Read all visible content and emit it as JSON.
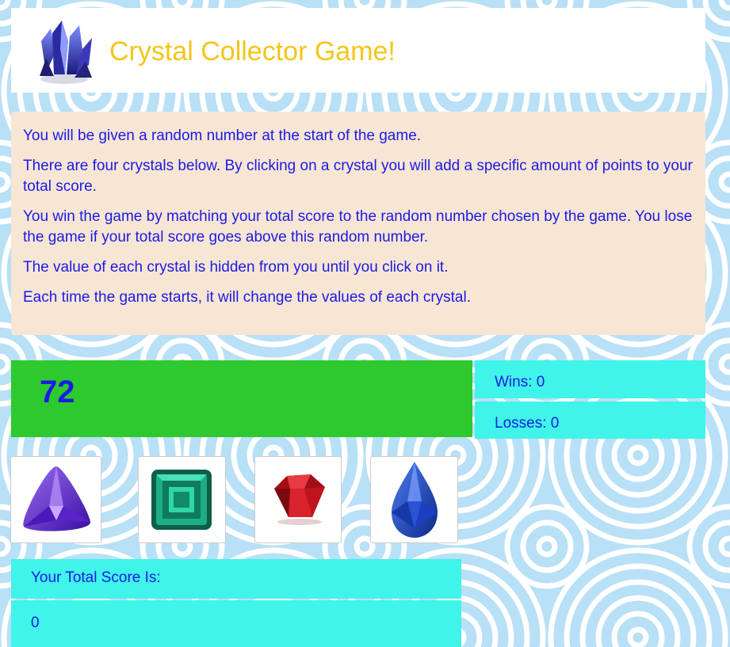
{
  "header": {
    "title": "Crystal Collector Game!"
  },
  "instructions": [
    "You will be given a random number at the start of the game.",
    "There are four crystals below. By clicking on a crystal you will add a specific amount of points to your total score.",
    "You win the game by matching your total score to the random number chosen by the game. You lose the game if your total score goes above this random number.",
    "The value of each crystal is hidden from you until you click on it.",
    "Each time the game starts, it will change the values of each crystal."
  ],
  "target_number": "72",
  "stats": {
    "wins_label": "Wins: 0",
    "losses_label": "Losses: 0"
  },
  "crystals": [
    {
      "name": "purple-crystal-icon",
      "color": "#6a2fd6"
    },
    {
      "name": "green-crystal-icon",
      "color": "#1fae84"
    },
    {
      "name": "red-crystal-icon",
      "color": "#c0141c"
    },
    {
      "name": "blue-crystal-icon",
      "color": "#1b3fbf"
    }
  ],
  "score": {
    "label": "Your Total Score Is:",
    "value": "0"
  },
  "colors": {
    "title": "#f5c518",
    "text": "#1a1ae6",
    "instructions_bg": "#f8e6d4",
    "target_bg": "#2ec92e",
    "stat_bg": "#40f4ea"
  }
}
